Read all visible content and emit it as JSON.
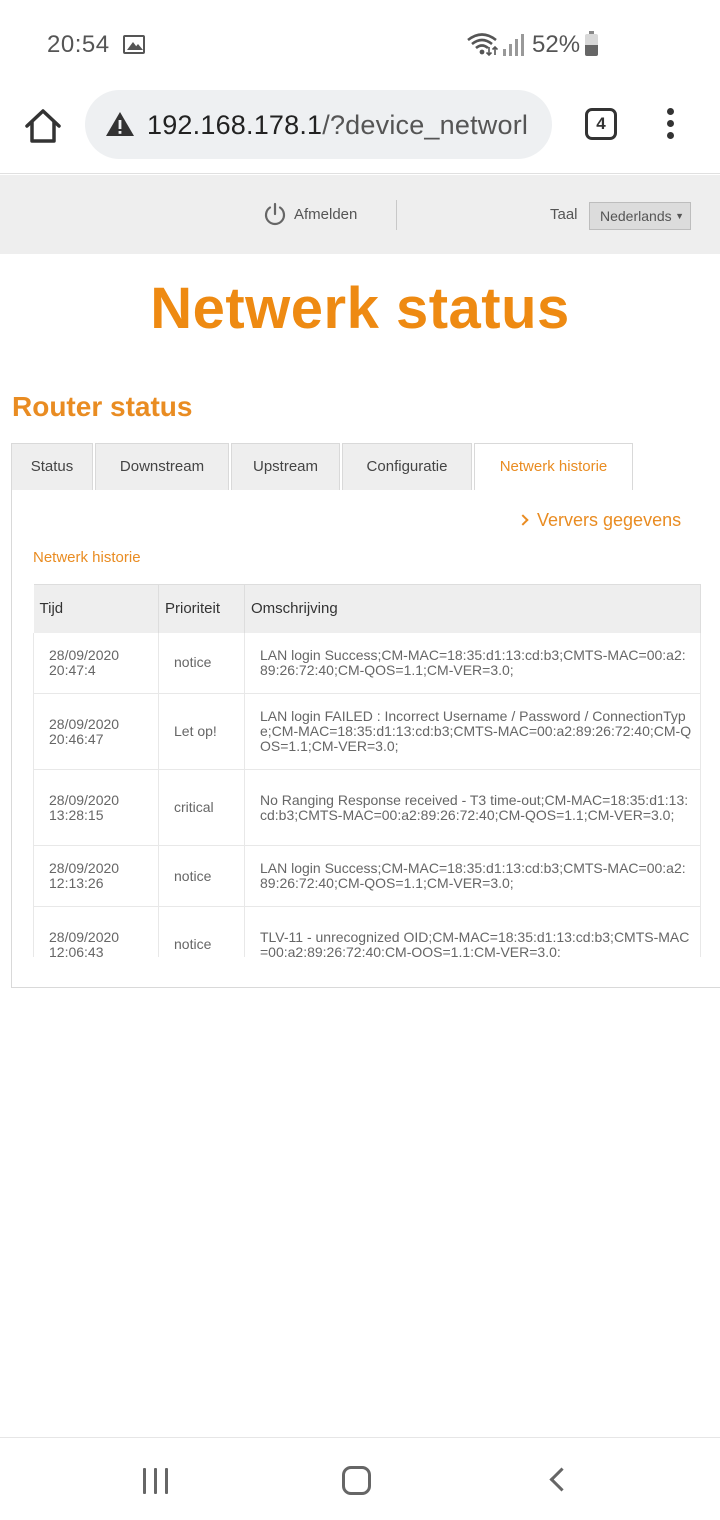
{
  "status_bar": {
    "time": "20:54",
    "battery": "52%"
  },
  "browser": {
    "url_host": "192.168.178.1",
    "url_path": "/?device_networl",
    "tab_count": "4"
  },
  "header": {
    "logout_label": "Afmelden",
    "language_label": "Taal",
    "language_value": "Nederlands"
  },
  "page": {
    "title": "Netwerk status",
    "section_title": "Router status"
  },
  "tabs": [
    {
      "label": "Status"
    },
    {
      "label": "Downstream"
    },
    {
      "label": "Upstream"
    },
    {
      "label": "Configuratie"
    },
    {
      "label": "Netwerk historie",
      "active": true
    }
  ],
  "panel": {
    "refresh_label": "Ververs gegevens",
    "subtitle": "Netwerk historie"
  },
  "table": {
    "headers": [
      "Tijd",
      "Prioriteit",
      "Omschrijving"
    ],
    "rows": [
      {
        "date": "28/09/2020",
        "time": "20:47:4",
        "priority": "notice",
        "description": "LAN login Success;CM-MAC=18:35:d1:13:cd:b3;CMTS-MAC=00:a2:89:26:72:40;CM-QOS=1.1;CM-VER=3.0;"
      },
      {
        "date": "28/09/2020",
        "time": "20:46:47",
        "priority": "Let op!",
        "description": "LAN login FAILED : Incorrect Username / Password / ConnectionType;CM-MAC=18:35:d1:13:cd:b3;CMTS-MAC=00:a2:89:26:72:40;CM-QOS=1.1;CM-VER=3.0;"
      },
      {
        "date": "28/09/2020",
        "time": "13:28:15",
        "priority": "critical",
        "description": "No Ranging Response received - T3 time-out;CM-MAC=18:35:d1:13:cd:b3;CMTS-MAC=00:a2:89:26:72:40;CM-QOS=1.1;CM-VER=3.0;"
      },
      {
        "date": "28/09/2020",
        "time": "12:13:26",
        "priority": "notice",
        "description": "LAN login Success;CM-MAC=18:35:d1:13:cd:b3;CMTS-MAC=00:a2:89:26:72:40;CM-QOS=1.1;CM-VER=3.0;"
      },
      {
        "date": "28/09/2020",
        "time": "12:06:43",
        "priority": "notice",
        "description": "TLV-11 - unrecognized OID;CM-MAC=18:35:d1:13:cd:b3;CMTS-MAC=00:a2:89:26:72:40;CM-QOS=1.1;CM-VER=3.0;"
      }
    ]
  },
  "colors": {
    "accent": "#ee8a12",
    "header_bg": "#eeeeee",
    "tab_bg": "#eeeeee"
  }
}
